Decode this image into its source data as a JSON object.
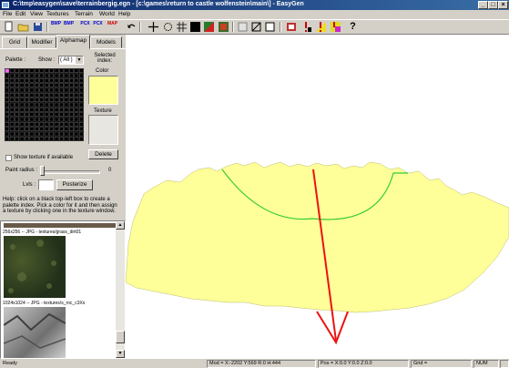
{
  "window": {
    "title": "C:\\tmp\\easygen\\save\\terrainbergig.egn - [c:\\games\\return to castle wolfenstein\\main\\] - EasyGen",
    "min_glyph": "_",
    "max_glyph": "□",
    "close_glyph": "×"
  },
  "menu": [
    "File",
    "Edit",
    "View",
    "Textures",
    "Terrain",
    "World",
    "Help"
  ],
  "toolbar": {
    "bmp_label": "BMP",
    "pcx_label": "PCX",
    "map_label": "MAP",
    "help_glyph": "?"
  },
  "tabs": [
    "Grid",
    "Modifier",
    "Alphamap",
    "Models"
  ],
  "alphamap": {
    "palette_label": "Palette :",
    "show_label": "Show :",
    "show_value": "( All )",
    "selected_index_label": "Selected index:",
    "color_label": "Color",
    "selected_color": "#ffff99",
    "texture_label": "Texture",
    "delete_label": "Delete",
    "show_texture_label": "Show texture if available",
    "paint_radius_label": "Paint radius :",
    "paint_radius_value": "0",
    "lvls_label": "Lvls :",
    "posterize_label": "Posterize",
    "help_text": "Help: click on a black top-left box to create a palette index. Pick a color for it and then assign a texture by clicking one in the texture window."
  },
  "textures": [
    {
      "caption": "256x256 -- JPG - textures/grass_dirt01",
      "kind": "grass"
    },
    {
      "caption": "1024x1024 -- JPG - textures/s_roc_c3Xs",
      "kind": "rock"
    }
  ],
  "status": {
    "ready": "Ready",
    "mod": "Mod = X:-2202 Y:569 R:0 H:444",
    "pos": "Pos = X:0.0 Y:0.0 Z:0.0",
    "grid": "Grid =",
    "num": "NUM"
  },
  "colors": {
    "terrain": "#ffff99",
    "curve": "#33cc33",
    "arrow": "#ee1111"
  }
}
